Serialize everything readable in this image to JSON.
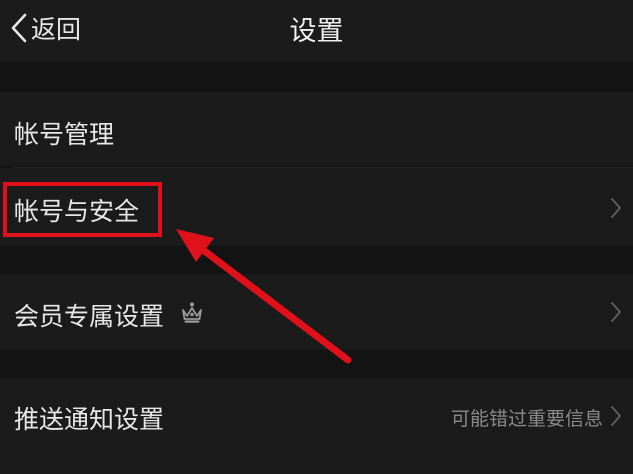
{
  "navbar": {
    "back_label": "返回",
    "title": "设置"
  },
  "settings": {
    "account_management": "帐号管理",
    "account_security": "帐号与安全",
    "member_settings": "会员专属设置",
    "push_settings": "推送通知设置",
    "push_value": "可能错过重要信息"
  },
  "colors": {
    "background": "#131313",
    "row": "#1b1b1b",
    "annotation": "#e0111b",
    "secondary_text": "#8a8a8a"
  },
  "icons": {
    "back": "chevron-left-icon",
    "row_arrow": "chevron-right-icon",
    "member": "crown-icon"
  }
}
